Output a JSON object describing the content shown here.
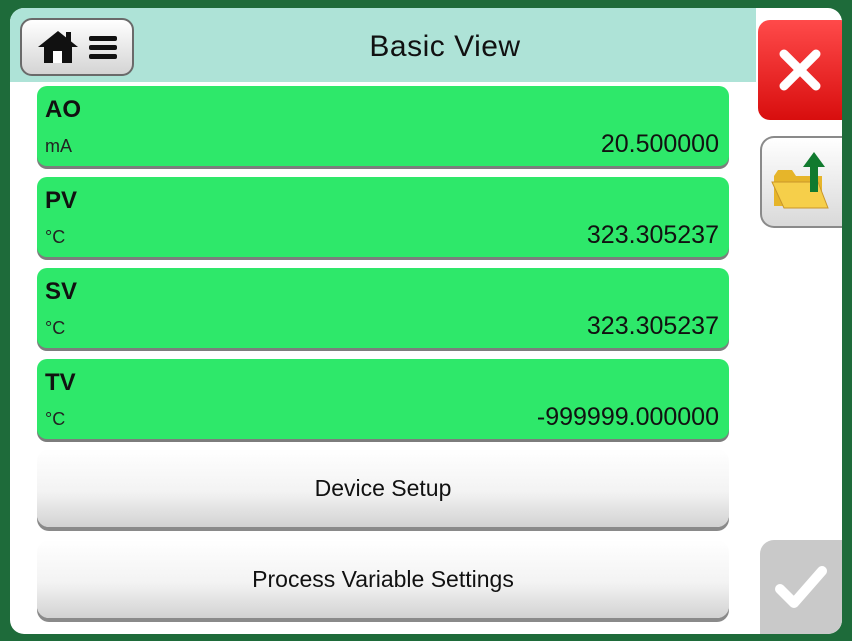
{
  "header": {
    "title": "Basic View",
    "home_icon": "home-icon",
    "menu_icon": "menu-icon"
  },
  "variables": [
    {
      "name": "AO",
      "unit": "mA",
      "value": "20.500000"
    },
    {
      "name": "PV",
      "unit": "°C",
      "value": "323.305237"
    },
    {
      "name": "SV",
      "unit": "°C",
      "value": "323.305237"
    },
    {
      "name": "TV",
      "unit": "°C",
      "value": "-999999.000000"
    }
  ],
  "buttons": {
    "device_setup": "Device Setup",
    "process_variable_settings": "Process Variable Settings"
  },
  "side": {
    "close_icon": "close-icon",
    "folder_icon": "folder-upload-icon",
    "accept_icon": "checkmark-icon"
  },
  "colors": {
    "frame": "#1e6b3a",
    "title_bar": "#aee3d7",
    "value_card": "#2ee86a",
    "close": "#e81818",
    "accept_disabled": "#c9c9c9"
  }
}
